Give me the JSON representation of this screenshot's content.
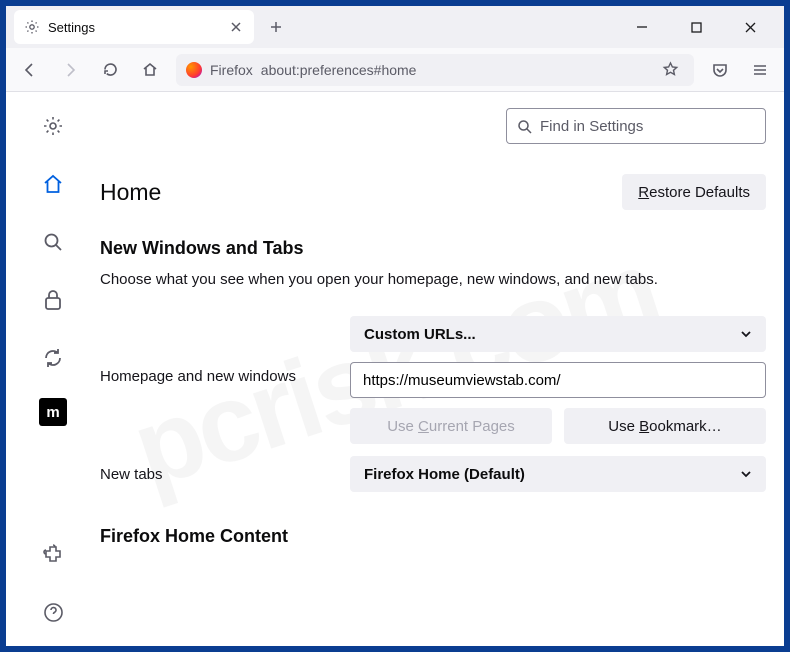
{
  "tab": {
    "title": "Settings"
  },
  "urlbar": {
    "context": "Firefox",
    "url": "about:preferences#home"
  },
  "search": {
    "placeholder": "Find in Settings"
  },
  "page": {
    "title": "Home",
    "restore": "Restore Defaults"
  },
  "section1": {
    "title": "New Windows and Tabs",
    "desc": "Choose what you see when you open your homepage, new windows, and new tabs."
  },
  "homepage": {
    "label": "Homepage and new windows",
    "select": "Custom URLs...",
    "url": "https://museumviewstab.com/",
    "useCurrent": "Use Current Pages",
    "useBookmark": "Use Bookmark…"
  },
  "newtabs": {
    "label": "New tabs",
    "select": "Firefox Home (Default)"
  },
  "section2": {
    "title": "Firefox Home Content"
  },
  "watermark": "pcrisk.com",
  "extIcon": "m"
}
